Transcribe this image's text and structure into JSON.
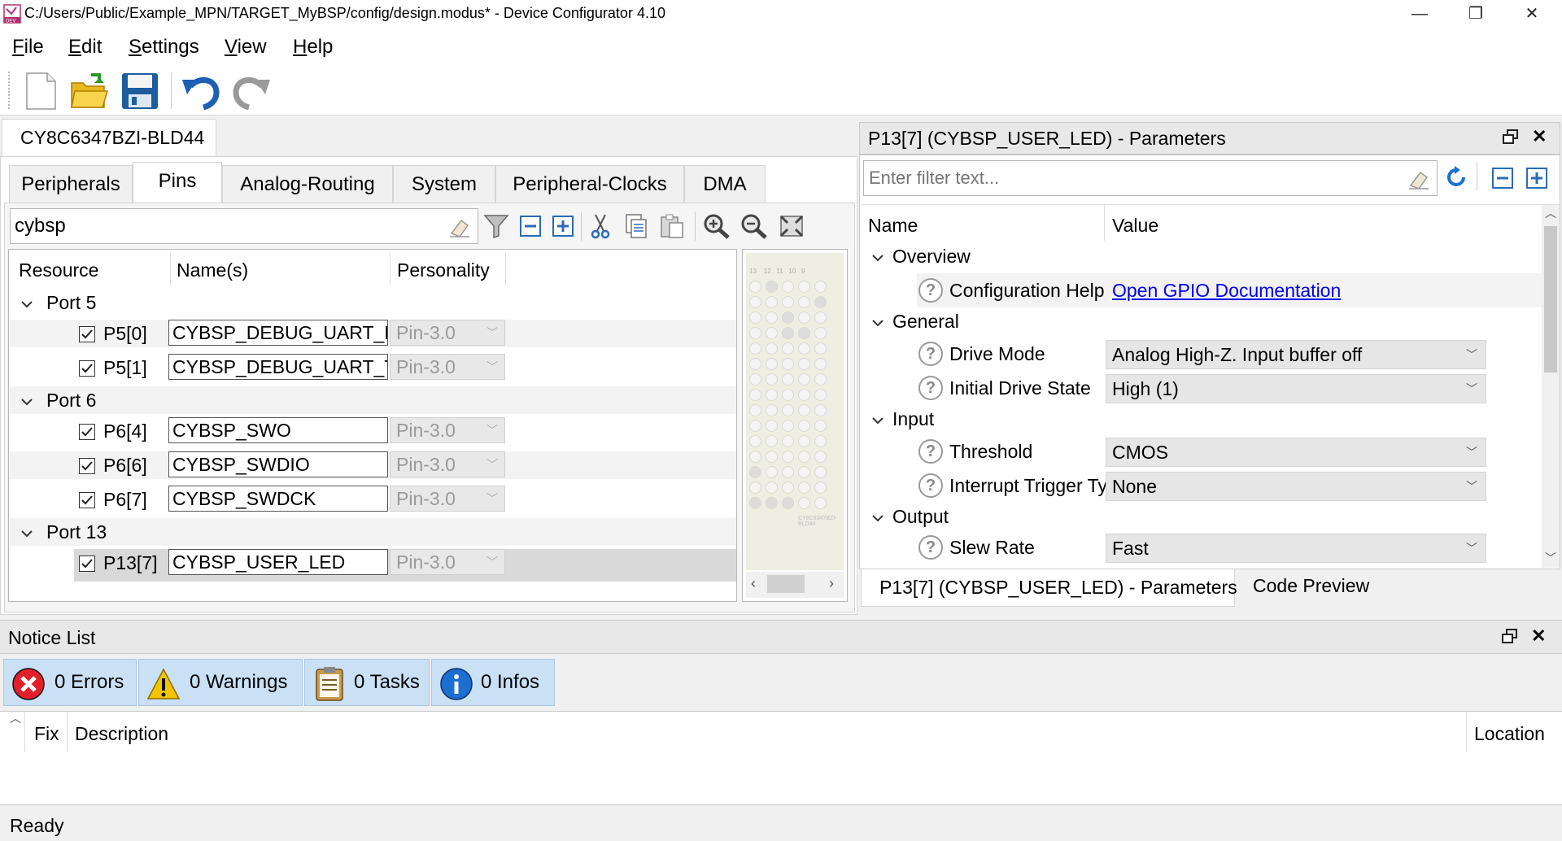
{
  "window": {
    "title": "C:/Users/Public/Example_MPN/TARGET_MyBSP/config/design.modus* - Device Configurator 4.10",
    "minimize": "—",
    "restore": "❐",
    "close": "✕"
  },
  "menu": {
    "items": [
      {
        "mnemonic": "F",
        "rest": "ile"
      },
      {
        "mnemonic": "E",
        "rest": "dit"
      },
      {
        "mnemonic": "S",
        "rest": "ettings"
      },
      {
        "mnemonic": "V",
        "rest": "iew"
      },
      {
        "mnemonic": "H",
        "rest": "elp"
      }
    ]
  },
  "device": {
    "tab_label": "CY8C6347BZI-BLD44",
    "tabs": [
      "Peripherals",
      "Pins",
      "Analog-Routing",
      "System",
      "Peripheral-Clocks",
      "DMA"
    ],
    "active_tab": "Pins"
  },
  "pins": {
    "filter_value": "cybsp",
    "columns": [
      "Resource",
      "Name(s)",
      "Personality"
    ],
    "groups": [
      {
        "label": "Port 5",
        "rows": [
          {
            "resource": "P5[0]",
            "name": "CYBSP_DEBUG_UART_RX",
            "personality": "Pin-3.0",
            "checked": true
          },
          {
            "resource": "P5[1]",
            "name": "CYBSP_DEBUG_UART_TX",
            "personality": "Pin-3.0",
            "checked": true
          }
        ]
      },
      {
        "label": "Port 6",
        "rows": [
          {
            "resource": "P6[4]",
            "name": "CYBSP_SWO",
            "personality": "Pin-3.0",
            "checked": true
          },
          {
            "resource": "P6[6]",
            "name": "CYBSP_SWDIO",
            "personality": "Pin-3.0",
            "checked": true
          },
          {
            "resource": "P6[7]",
            "name": "CYBSP_SWDCK",
            "personality": "Pin-3.0",
            "checked": true
          }
        ]
      },
      {
        "label": "Port 13",
        "rows": [
          {
            "resource": "P13[7]",
            "name": "CYBSP_USER_LED",
            "personality": "Pin-3.0",
            "checked": true
          }
        ]
      }
    ],
    "package_cols": [
      "13",
      "12",
      "11",
      "10",
      "9"
    ],
    "package_label": "CY8C6347BZI-BLD44"
  },
  "parameters": {
    "title": "P13[7] (CYBSP_USER_LED) - Parameters",
    "filter_placeholder": "Enter filter text...",
    "columns": [
      "Name",
      "Value"
    ],
    "sections": [
      {
        "label": "Overview",
        "rows": [
          {
            "name": "Configuration Help",
            "value": "Open GPIO Documentation",
            "type": "link"
          }
        ]
      },
      {
        "label": "General",
        "rows": [
          {
            "name": "Drive Mode",
            "value": "Analog High-Z. Input buffer off",
            "type": "select"
          },
          {
            "name": "Initial Drive State",
            "value": "High (1)",
            "type": "select"
          }
        ]
      },
      {
        "label": "Input",
        "rows": [
          {
            "name": "Threshold",
            "value": "CMOS",
            "type": "select"
          },
          {
            "name": "Interrupt Trigger Type",
            "value": "None",
            "type": "select"
          }
        ]
      },
      {
        "label": "Output",
        "rows": [
          {
            "name": "Slew Rate",
            "value": "Fast",
            "type": "select"
          }
        ]
      }
    ],
    "bottom_tabs": [
      "P13[7] (CYBSP_USER_LED) - Parameters",
      "Code Preview"
    ],
    "help_glyph": "?"
  },
  "notices": {
    "title": "Notice List",
    "buttons": [
      {
        "label": "0 Errors",
        "icon": "error-icon",
        "color": "#e3202a"
      },
      {
        "label": "0 Warnings",
        "icon": "warning-icon",
        "color": "#f5c400"
      },
      {
        "label": "0 Tasks",
        "icon": "tasks-icon",
        "color": "#c99a4a"
      },
      {
        "label": "0 Infos",
        "icon": "info-icon",
        "color": "#1a6fd1"
      }
    ],
    "columns": [
      "Fix",
      "Description",
      "Location"
    ]
  },
  "status": {
    "text": "Ready"
  },
  "colors": {
    "accent": "#1a6fd1",
    "link": "#0000ee",
    "selected_row": "#d9d9d9"
  }
}
